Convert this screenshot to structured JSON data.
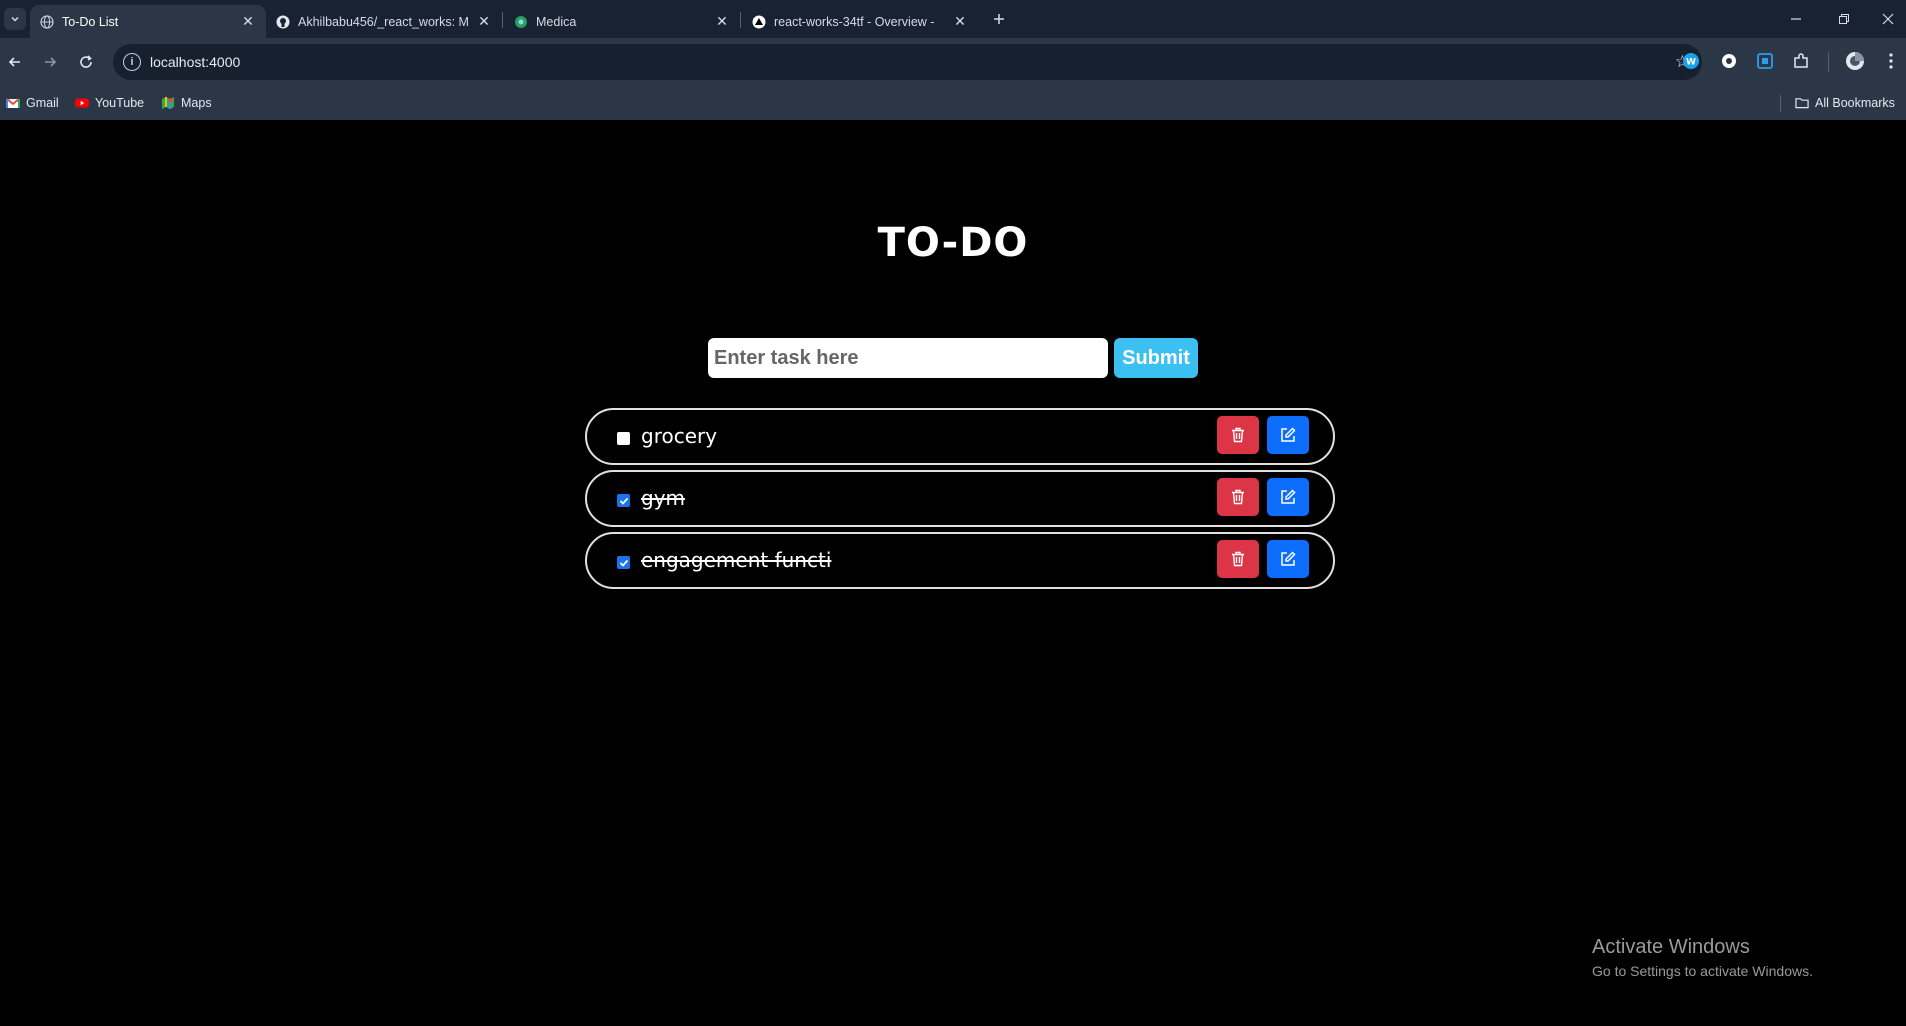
{
  "browser": {
    "tabs": [
      {
        "title": "To-Do List",
        "active": true
      },
      {
        "title": "Akhilbabu456/_react_works: M",
        "active": false
      },
      {
        "title": "Medica",
        "active": false
      },
      {
        "title": "react-works-34tf - Overview -",
        "active": false
      }
    ],
    "url": "localhost:4000",
    "bookmarks": [
      "Gmail",
      "YouTube",
      "Maps"
    ],
    "all_bookmarks": "All Bookmarks"
  },
  "app": {
    "title": "TO-DO",
    "input_placeholder": "Enter task here",
    "submit_label": "Submit",
    "todos": [
      {
        "text": "grocery",
        "done": false
      },
      {
        "text": "gym",
        "done": true
      },
      {
        "text": "engagement functi",
        "done": true
      }
    ]
  },
  "watermark": {
    "line1": "Activate Windows",
    "line2": "Go to Settings to activate Windows."
  },
  "colors": {
    "submit": "#3cc0f2",
    "delete": "#dc3545",
    "edit": "#0d6efd"
  }
}
